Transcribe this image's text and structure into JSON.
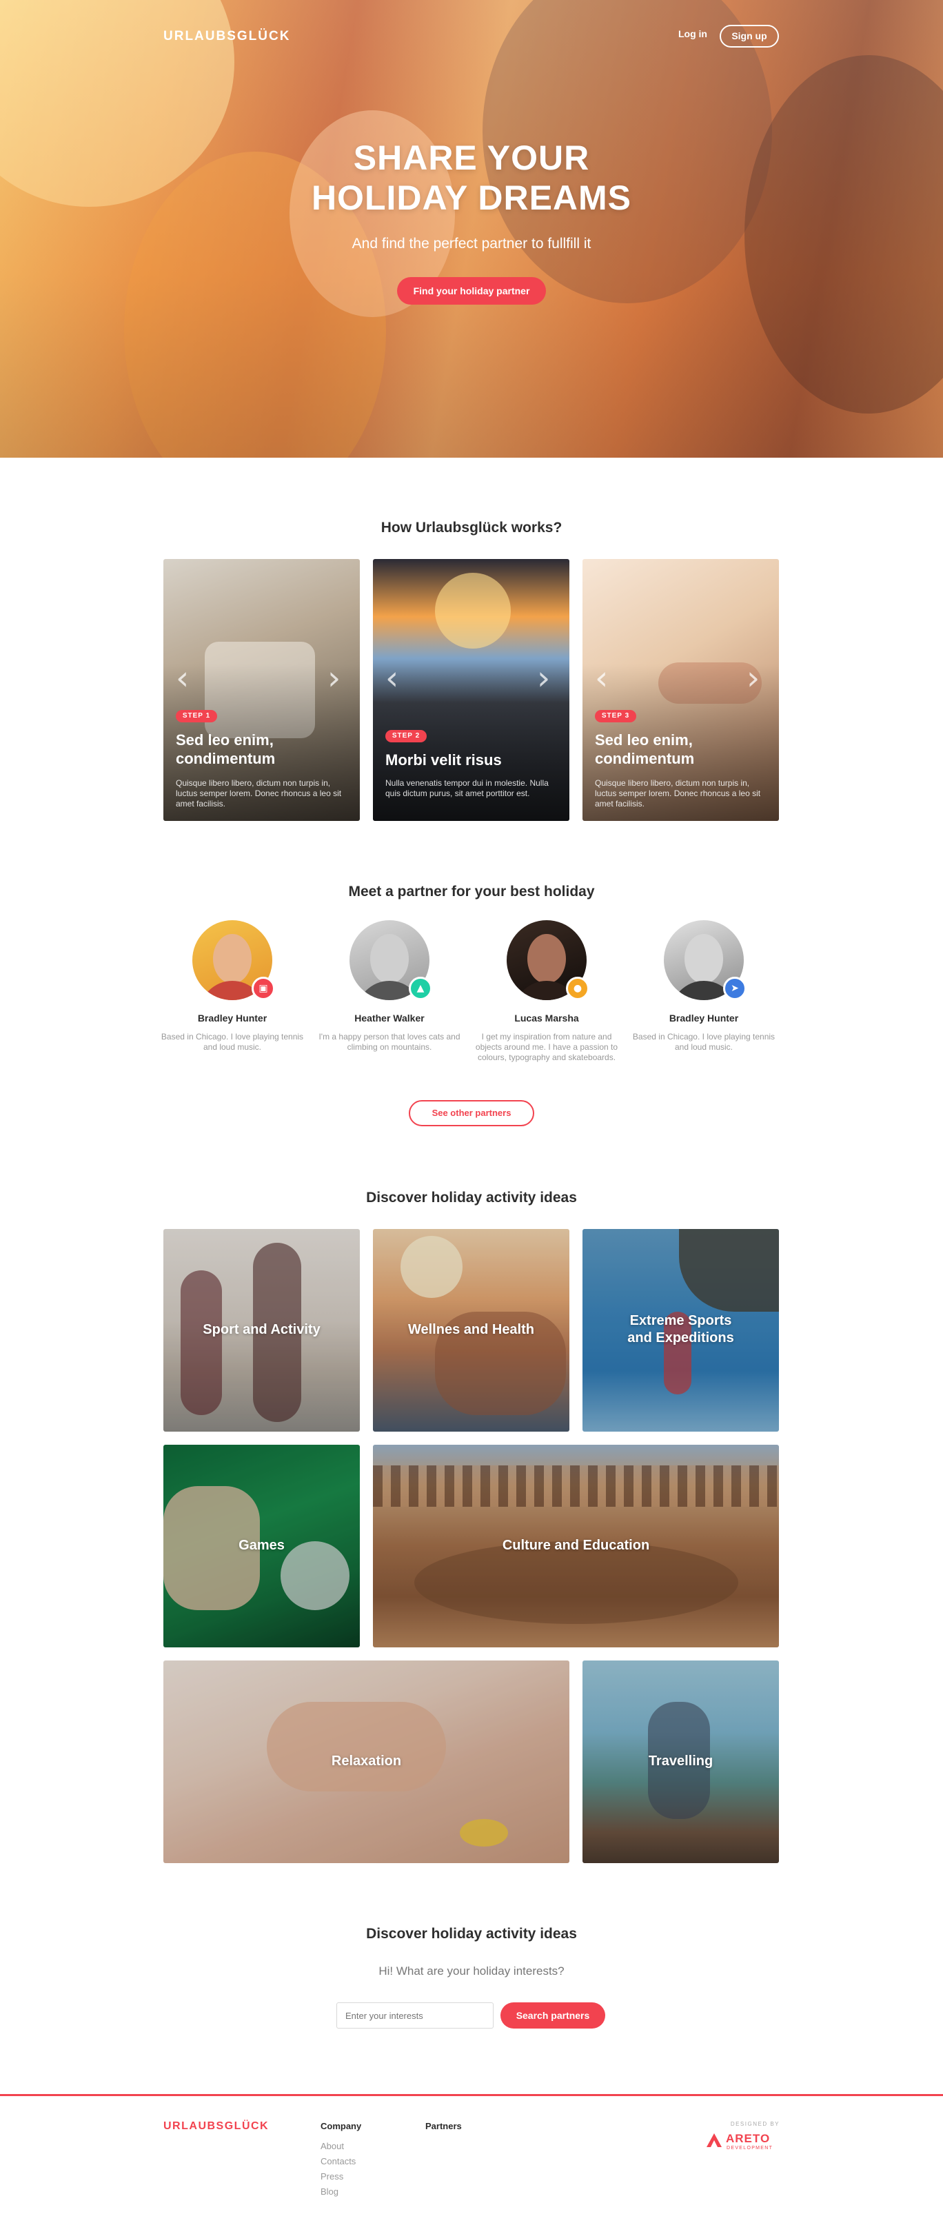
{
  "header": {
    "brand": "URLAUBSGLÜCK",
    "login_label": "Log in",
    "signup_label": "Sign up"
  },
  "hero": {
    "title_line1": "SHARE YOUR",
    "title_line2": "HOLIDAY DREAMS",
    "subtitle": "And find the perfect partner to fullfill it",
    "cta_label": "Find your holiday partner"
  },
  "how_it_works": {
    "title": "How Urlaubsglück works?",
    "steps": [
      {
        "badge": "STEP 1",
        "title": "Sed leo enim, condimentum",
        "text": "Quisque libero libero, dictum non turpis in, luctus semper lorem. Donec rhoncus a leo sit amet facilisis."
      },
      {
        "badge": "STEP 2",
        "title": "Morbi velit risus",
        "text": "Nulla venenatis tempor dui in molestie. Nulla quis dictum purus, sit amet porttitor est."
      },
      {
        "badge": "STEP 3",
        "title": "Sed leo enim, condimentum",
        "text": "Quisque libero libero, dictum non turpis in, luctus semper lorem. Donec rhoncus a leo sit amet facilisis."
      }
    ]
  },
  "partners": {
    "title": "Meet a partner for your best holiday",
    "items": [
      {
        "name": "Bradley Hunter",
        "bio": "Based in Chicago. I love playing tennis and loud music.",
        "icon": "calendar-icon",
        "icon_glyph": "▣",
        "icon_color": "#f2434f"
      },
      {
        "name": "Heather Walker",
        "bio": "I'm a happy person that loves cats and climbing on mountains.",
        "icon": "mountain-icon",
        "icon_glyph": "▲",
        "icon_color": "#1ecfa5"
      },
      {
        "name": "Lucas Marsha",
        "bio": "I get my inspiration from nature and objects around me. I have a passion to colours, typography and skateboards.",
        "icon": "lock-icon",
        "icon_glyph": "●",
        "icon_color": "#f5a623"
      },
      {
        "name": "Bradley Hunter",
        "bio": "Based in Chicago. I love playing tennis and loud music.",
        "icon": "plane-icon",
        "icon_glyph": "➤",
        "icon_color": "#3d7be0"
      }
    ],
    "see_more_label": "See other partners"
  },
  "activities": {
    "title": "Discover holiday activity ideas",
    "items": [
      {
        "label": "Sport and Activity"
      },
      {
        "label": "Wellnes and Health"
      },
      {
        "label": "Extreme Sports and Expeditions"
      },
      {
        "label": "Games"
      },
      {
        "label": "Culture and Education"
      },
      {
        "label": "Relaxation"
      },
      {
        "label": "Travelling"
      }
    ]
  },
  "search": {
    "title": "Discover holiday activity ideas",
    "question": "Hi! What are your holiday interests?",
    "placeholder": "Enter your interests",
    "button_label": "Search partners"
  },
  "footer": {
    "brand": "URLAUBSGLÜCK",
    "company_heading": "Company",
    "company_links": [
      "About",
      "Contacts",
      "Press",
      "Blog"
    ],
    "partners_heading": "Partners",
    "designed_by": "DESIGNED BY",
    "designer_name": "ARETO",
    "designer_sub": "DEVELOPMENT"
  },
  "colors": {
    "accent": "#f2434f"
  }
}
